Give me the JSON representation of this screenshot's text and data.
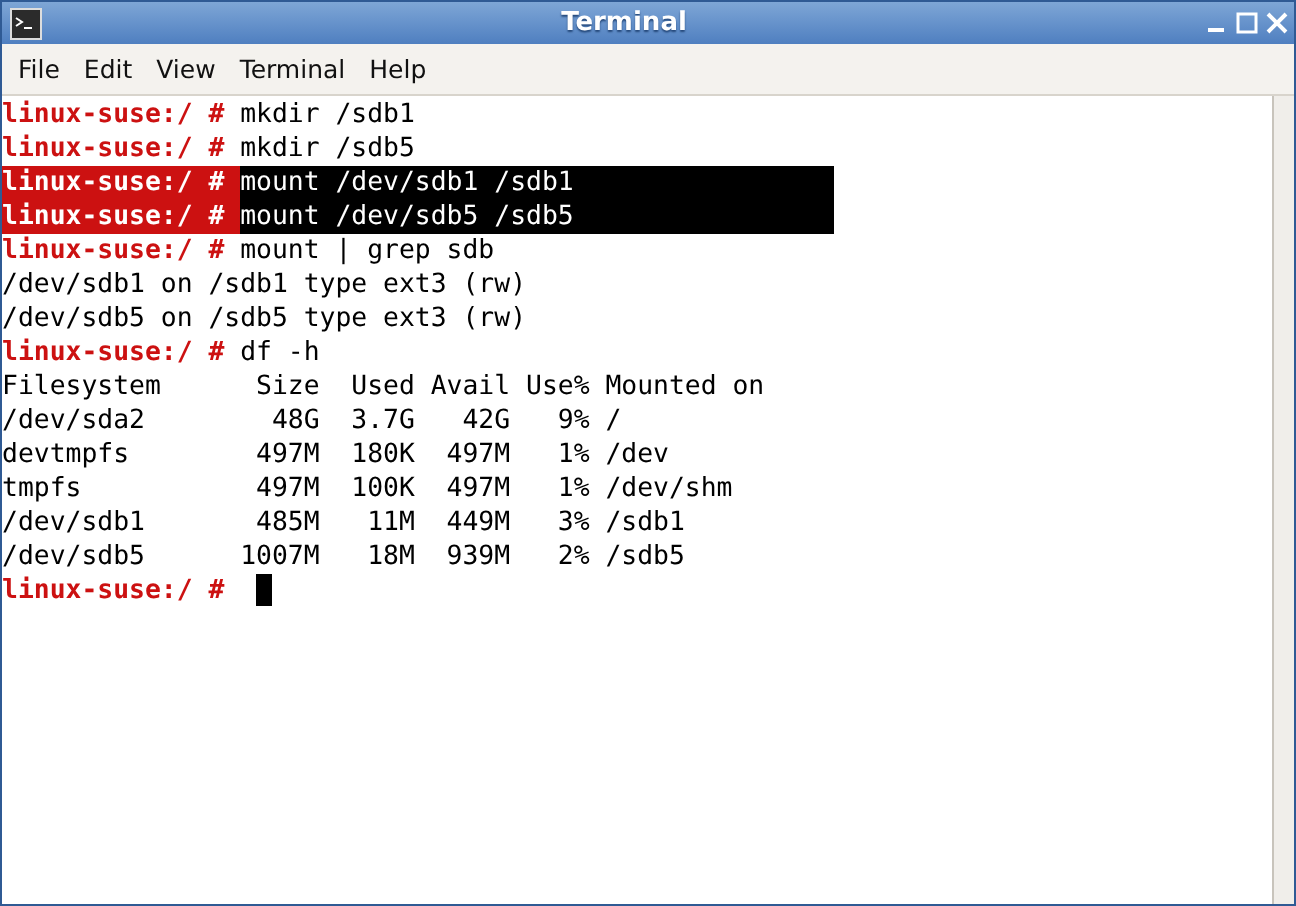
{
  "window": {
    "title": "Terminal"
  },
  "menu": [
    "File",
    "Edit",
    "View",
    "Terminal",
    "Help"
  ],
  "lines": [
    {
      "kind": "prompt",
      "prompt": "linux-suse:/ #",
      "command": "mkdir /sdb1",
      "selected": false
    },
    {
      "kind": "prompt",
      "prompt": "linux-suse:/ #",
      "command": "mkdir /sdb5",
      "selected": false
    },
    {
      "kind": "prompt",
      "prompt": "linux-suse:/ #",
      "command": "mount /dev/sdb1 /sdb1",
      "selected": true
    },
    {
      "kind": "prompt",
      "prompt": "linux-suse:/ #",
      "command": "mount /dev/sdb5 /sdb5",
      "selected": true
    },
    {
      "kind": "prompt",
      "prompt": "linux-suse:/ #",
      "command": "mount | grep sdb",
      "selected": false
    },
    {
      "kind": "output",
      "text": "/dev/sdb1 on /sdb1 type ext3 (rw)"
    },
    {
      "kind": "output",
      "text": "/dev/sdb5 on /sdb5 type ext3 (rw)"
    },
    {
      "kind": "prompt",
      "prompt": "linux-suse:/ #",
      "command": "df -h",
      "selected": false
    },
    {
      "kind": "output",
      "text": "Filesystem      Size  Used Avail Use% Mounted on"
    },
    {
      "kind": "output",
      "text": "/dev/sda2        48G  3.7G   42G   9% /"
    },
    {
      "kind": "output",
      "text": "devtmpfs        497M  180K  497M   1% /dev"
    },
    {
      "kind": "output",
      "text": "tmpfs           497M  100K  497M   1% /dev/shm"
    },
    {
      "kind": "output",
      "text": "/dev/sdb1       485M   11M  449M   3% /sdb1"
    },
    {
      "kind": "output",
      "text": "/dev/sdb5      1007M   18M  939M   2% /sdb5"
    },
    {
      "kind": "cursor",
      "prompt": "linux-suse:/ #"
    }
  ]
}
